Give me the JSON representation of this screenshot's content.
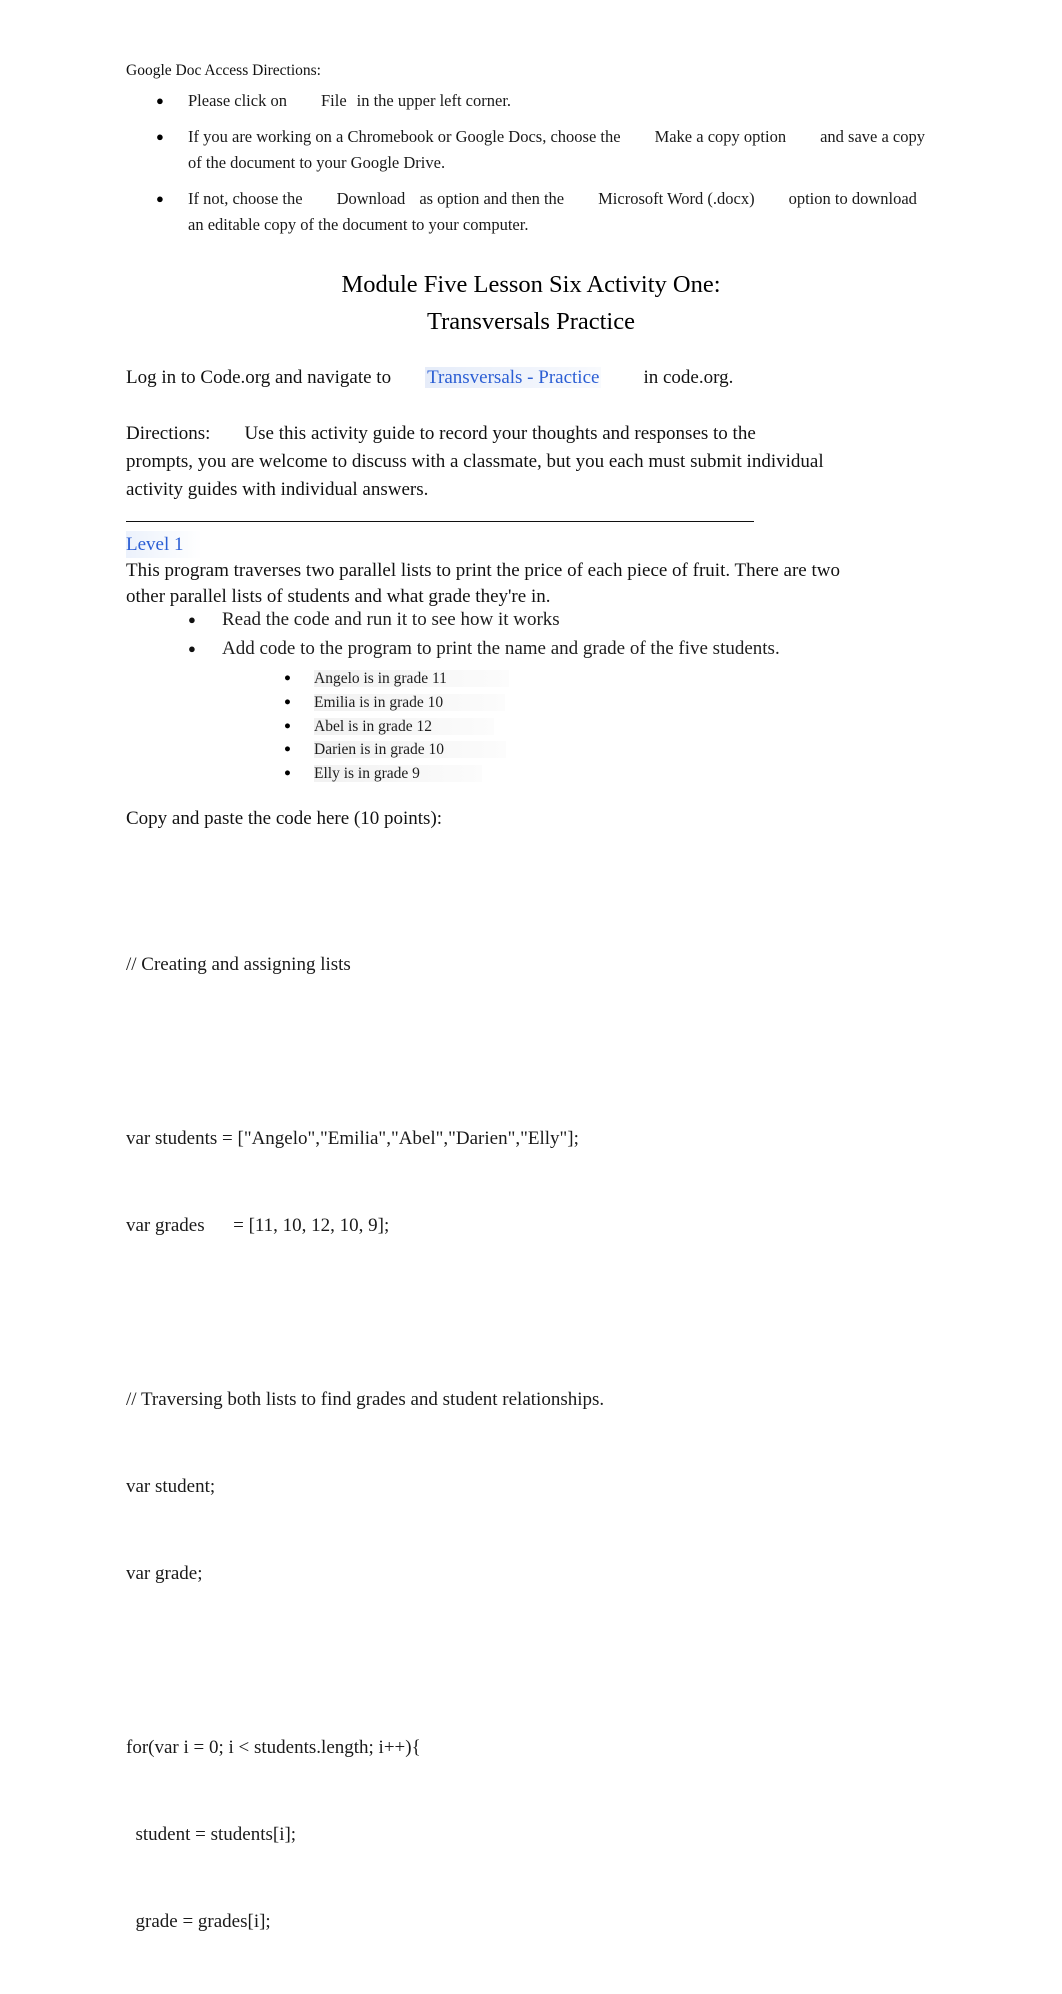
{
  "access": {
    "heading": "Google Doc Access Directions:",
    "bullet_glyph": "●",
    "items": [
      {
        "parts": [
          {
            "text": "Please click on",
            "style": "normal"
          },
          {
            "text": "File",
            "style": "emphasis"
          },
          {
            "text": "in the upper left corner.",
            "style": "normal"
          }
        ]
      },
      {
        "parts": [
          {
            "text": "If you are working on a Chromebook or Google Docs, choose the",
            "style": "normal"
          },
          {
            "text": "Make a copy option",
            "style": "emphasis"
          },
          {
            "text": "and save a copy of the document to your Google Drive.",
            "style": "normal"
          }
        ]
      },
      {
        "parts": [
          {
            "text": "If not, choose the",
            "style": "normal"
          },
          {
            "text": "Download",
            "style": "emphasis"
          },
          {
            "text": "as option and then the",
            "style": "normal"
          },
          {
            "text": "Microsoft Word (.docx)",
            "style": "emphasis"
          },
          {
            "text": "option to download an editable copy of the document to your computer.",
            "style": "normal"
          }
        ]
      }
    ]
  },
  "title": {
    "line1": "Module Five Lesson Six Activity One:",
    "line2": "Transversals Practice"
  },
  "login_line": {
    "before": "Log in to Code.org and navigate to",
    "link_text": "Transversals - Practice",
    "after": "in code.org."
  },
  "directions": {
    "label": "Directions:",
    "body": "Use this activity guide to record your thoughts and responses to the prompts, you are welcome to discuss with a classmate, but you each must submit individual activity guides with individual answers."
  },
  "level": {
    "heading": "Level 1",
    "heading_color": "#2b5ed4",
    "description": "This program traverses two parallel lists to print the price of each piece of fruit. There are two other parallel lists of students and what grade they're in.",
    "tasks": [
      "Read the code and run it to see how it works",
      "Add code to the program to print the name and grade of the five students."
    ],
    "students": [
      "Angelo is in grade 11",
      "Emilia is in grade 10",
      "Abel is in grade 12",
      "Darien is in grade 10",
      "Elly is in grade 9"
    ]
  },
  "copy_prompt": "Copy and paste the code here (10 points):",
  "code": {
    "lines": [
      "// Creating and assigning lists",
      "",
      "var students = [\"Angelo\",\"Emilia\",\"Abel\",\"Darien\",\"Elly\"];",
      "var grades      = [11, 10, 12, 10, 9];",
      "",
      "// Traversing both lists to find grades and student relationships.",
      "var student;",
      "var grade;",
      "",
      "for(var i = 0; i < students.length; i++){",
      "  student = students[i];",
      "  grade = grades[i];"
    ]
  }
}
